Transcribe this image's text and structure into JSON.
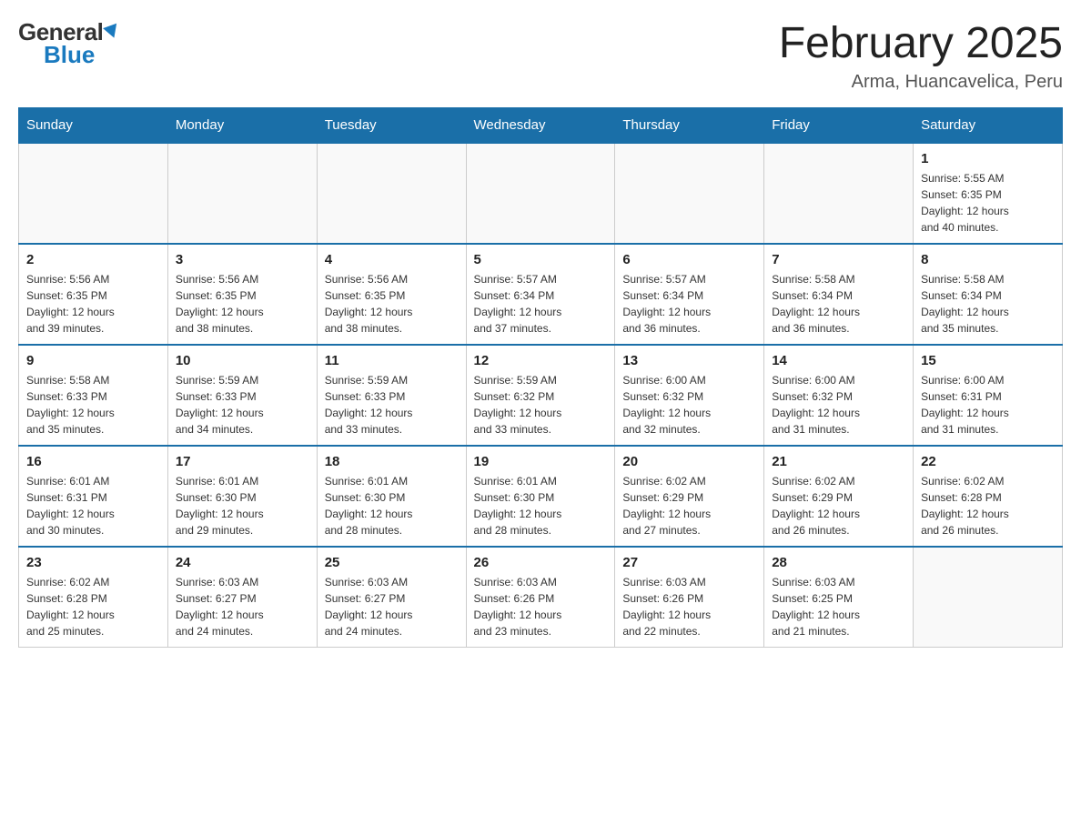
{
  "logo": {
    "general": "General",
    "blue": "Blue"
  },
  "title": "February 2025",
  "location": "Arma, Huancavelica, Peru",
  "days_of_week": [
    "Sunday",
    "Monday",
    "Tuesday",
    "Wednesday",
    "Thursday",
    "Friday",
    "Saturday"
  ],
  "weeks": [
    [
      {
        "day": "",
        "info": ""
      },
      {
        "day": "",
        "info": ""
      },
      {
        "day": "",
        "info": ""
      },
      {
        "day": "",
        "info": ""
      },
      {
        "day": "",
        "info": ""
      },
      {
        "day": "",
        "info": ""
      },
      {
        "day": "1",
        "info": "Sunrise: 5:55 AM\nSunset: 6:35 PM\nDaylight: 12 hours\nand 40 minutes."
      }
    ],
    [
      {
        "day": "2",
        "info": "Sunrise: 5:56 AM\nSunset: 6:35 PM\nDaylight: 12 hours\nand 39 minutes."
      },
      {
        "day": "3",
        "info": "Sunrise: 5:56 AM\nSunset: 6:35 PM\nDaylight: 12 hours\nand 38 minutes."
      },
      {
        "day": "4",
        "info": "Sunrise: 5:56 AM\nSunset: 6:35 PM\nDaylight: 12 hours\nand 38 minutes."
      },
      {
        "day": "5",
        "info": "Sunrise: 5:57 AM\nSunset: 6:34 PM\nDaylight: 12 hours\nand 37 minutes."
      },
      {
        "day": "6",
        "info": "Sunrise: 5:57 AM\nSunset: 6:34 PM\nDaylight: 12 hours\nand 36 minutes."
      },
      {
        "day": "7",
        "info": "Sunrise: 5:58 AM\nSunset: 6:34 PM\nDaylight: 12 hours\nand 36 minutes."
      },
      {
        "day": "8",
        "info": "Sunrise: 5:58 AM\nSunset: 6:34 PM\nDaylight: 12 hours\nand 35 minutes."
      }
    ],
    [
      {
        "day": "9",
        "info": "Sunrise: 5:58 AM\nSunset: 6:33 PM\nDaylight: 12 hours\nand 35 minutes."
      },
      {
        "day": "10",
        "info": "Sunrise: 5:59 AM\nSunset: 6:33 PM\nDaylight: 12 hours\nand 34 minutes."
      },
      {
        "day": "11",
        "info": "Sunrise: 5:59 AM\nSunset: 6:33 PM\nDaylight: 12 hours\nand 33 minutes."
      },
      {
        "day": "12",
        "info": "Sunrise: 5:59 AM\nSunset: 6:32 PM\nDaylight: 12 hours\nand 33 minutes."
      },
      {
        "day": "13",
        "info": "Sunrise: 6:00 AM\nSunset: 6:32 PM\nDaylight: 12 hours\nand 32 minutes."
      },
      {
        "day": "14",
        "info": "Sunrise: 6:00 AM\nSunset: 6:32 PM\nDaylight: 12 hours\nand 31 minutes."
      },
      {
        "day": "15",
        "info": "Sunrise: 6:00 AM\nSunset: 6:31 PM\nDaylight: 12 hours\nand 31 minutes."
      }
    ],
    [
      {
        "day": "16",
        "info": "Sunrise: 6:01 AM\nSunset: 6:31 PM\nDaylight: 12 hours\nand 30 minutes."
      },
      {
        "day": "17",
        "info": "Sunrise: 6:01 AM\nSunset: 6:30 PM\nDaylight: 12 hours\nand 29 minutes."
      },
      {
        "day": "18",
        "info": "Sunrise: 6:01 AM\nSunset: 6:30 PM\nDaylight: 12 hours\nand 28 minutes."
      },
      {
        "day": "19",
        "info": "Sunrise: 6:01 AM\nSunset: 6:30 PM\nDaylight: 12 hours\nand 28 minutes."
      },
      {
        "day": "20",
        "info": "Sunrise: 6:02 AM\nSunset: 6:29 PM\nDaylight: 12 hours\nand 27 minutes."
      },
      {
        "day": "21",
        "info": "Sunrise: 6:02 AM\nSunset: 6:29 PM\nDaylight: 12 hours\nand 26 minutes."
      },
      {
        "day": "22",
        "info": "Sunrise: 6:02 AM\nSunset: 6:28 PM\nDaylight: 12 hours\nand 26 minutes."
      }
    ],
    [
      {
        "day": "23",
        "info": "Sunrise: 6:02 AM\nSunset: 6:28 PM\nDaylight: 12 hours\nand 25 minutes."
      },
      {
        "day": "24",
        "info": "Sunrise: 6:03 AM\nSunset: 6:27 PM\nDaylight: 12 hours\nand 24 minutes."
      },
      {
        "day": "25",
        "info": "Sunrise: 6:03 AM\nSunset: 6:27 PM\nDaylight: 12 hours\nand 24 minutes."
      },
      {
        "day": "26",
        "info": "Sunrise: 6:03 AM\nSunset: 6:26 PM\nDaylight: 12 hours\nand 23 minutes."
      },
      {
        "day": "27",
        "info": "Sunrise: 6:03 AM\nSunset: 6:26 PM\nDaylight: 12 hours\nand 22 minutes."
      },
      {
        "day": "28",
        "info": "Sunrise: 6:03 AM\nSunset: 6:25 PM\nDaylight: 12 hours\nand 21 minutes."
      },
      {
        "day": "",
        "info": ""
      }
    ]
  ]
}
